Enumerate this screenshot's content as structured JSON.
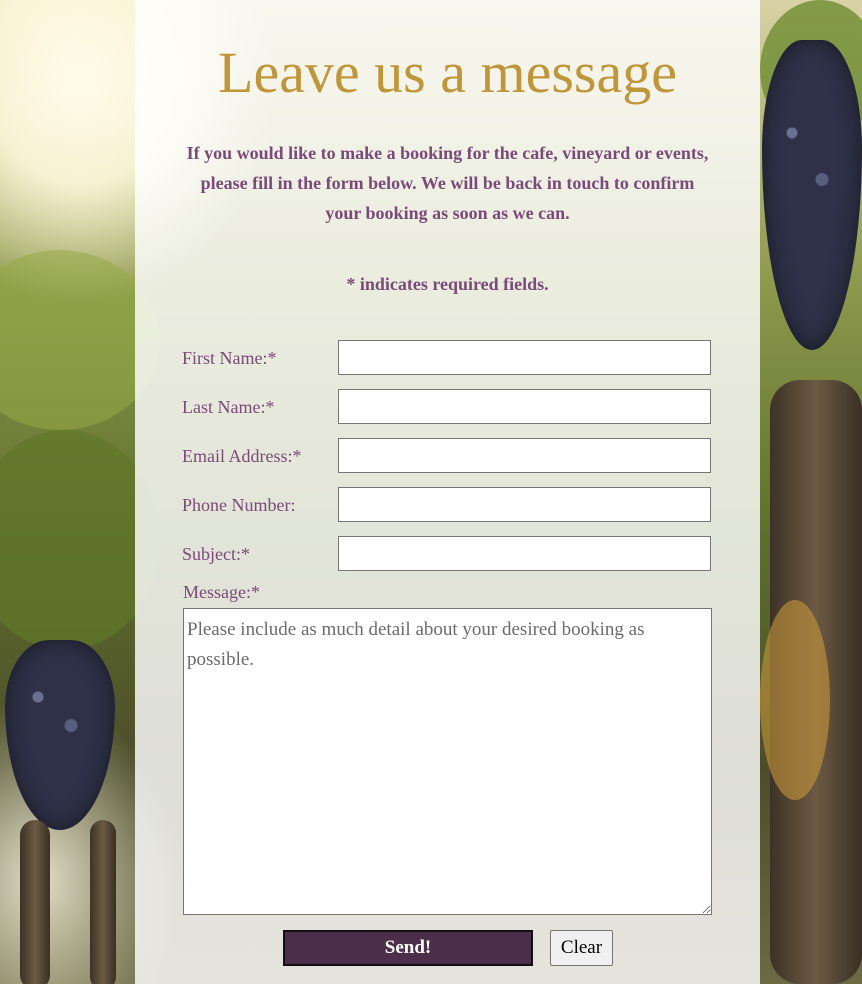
{
  "page": {
    "title": "Leave us a message",
    "intro": "If you would like to make a booking for the cafe, vineyard or events, please fill in the form below. We will be back in touch to confirm your booking as soon as we can.",
    "required_note": "* indicates required fields."
  },
  "form": {
    "first_name_label": "First Name:*",
    "last_name_label": "Last Name:*",
    "email_label": "Email Address:*",
    "phone_label": "Phone Number:",
    "subject_label": "Subject:*",
    "message_label": "Message:*",
    "message_placeholder": "Please include as much detail about your desired booking as possible.",
    "send_label": "Send!",
    "clear_label": "Clear"
  },
  "colors": {
    "title": "#c0963a",
    "text": "#7a4a78",
    "send_button": "#4d2e4a"
  }
}
